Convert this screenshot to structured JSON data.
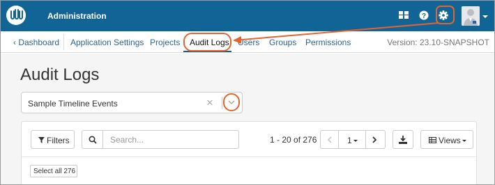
{
  "header": {
    "app_title": "Administration",
    "logo_icon": "labkey-logo-icon",
    "icons": [
      "apps-grid-icon",
      "help-icon",
      "gear-icon",
      "user-avatar-icon"
    ]
  },
  "subnav": {
    "back_label": "Dashboard",
    "tabs": [
      {
        "label": "Application Settings"
      },
      {
        "label": "Projects"
      },
      {
        "label": "Audit Logs",
        "active": true
      },
      {
        "label": "Users"
      },
      {
        "label": "Groups"
      },
      {
        "label": "Permissions"
      }
    ],
    "version": "Version: 23.10-SNAPSHOT"
  },
  "page": {
    "title": "Audit Logs",
    "log_select": {
      "value": "Sample Timeline Events"
    }
  },
  "grid": {
    "filters_label": "Filters",
    "search_placeholder": "Search...",
    "paging_text": "1 - 20 of 276",
    "page_label": "1",
    "views_label": "Views",
    "select_all_label": "Select all 276"
  },
  "colors": {
    "header_bg": "#116596",
    "highlight": "#e5642d",
    "link": "#2a6496"
  }
}
